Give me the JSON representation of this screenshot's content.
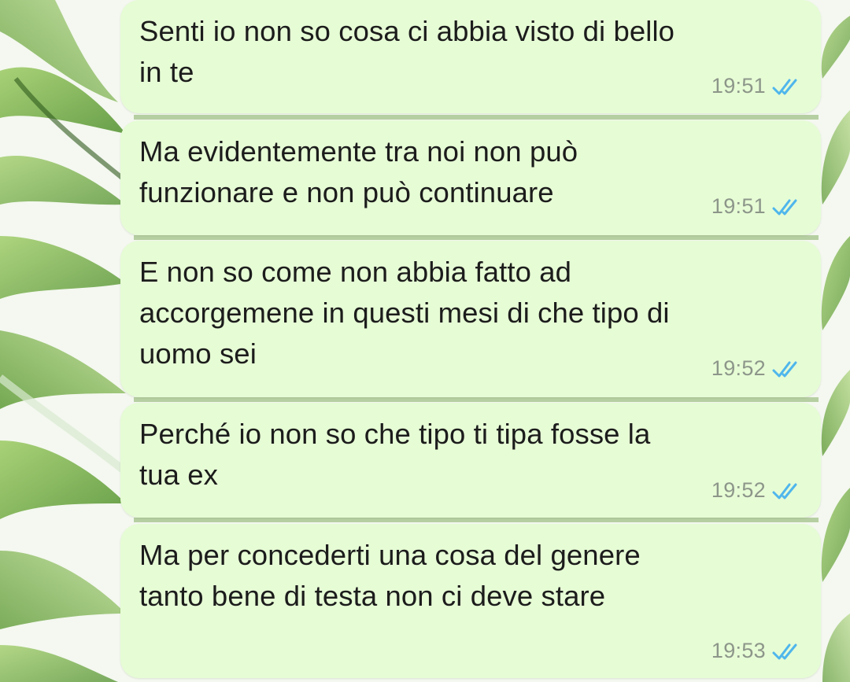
{
  "theme": {
    "bubble_color": "#e6fcd5",
    "text_color": "#1c1c1c",
    "time_color": "#8d968a",
    "read_tick_color": "#4fb6ec",
    "wallpaper_leaf_color": "#7fb94a"
  },
  "messages": [
    {
      "lines": [
        "Senti io non so cosa ci abbia visto di bello",
        "in te"
      ],
      "time": "19:51",
      "status_icon": "double-check-read-icon"
    },
    {
      "lines": [
        "Ma evidentemente tra noi non può",
        "funzionare e non può continuare"
      ],
      "time": "19:51",
      "status_icon": "double-check-read-icon"
    },
    {
      "lines": [
        "E non so come non abbia fatto ad",
        "accorgemene in questi mesi di che tipo di",
        "uomo sei"
      ],
      "time": "19:52",
      "status_icon": "double-check-read-icon"
    },
    {
      "lines": [
        "Perché io non so che tipo ti tipa fosse la",
        "tua ex"
      ],
      "time": "19:52",
      "status_icon": "double-check-read-icon"
    },
    {
      "lines": [
        "Ma per concederti una cosa del genere",
        "tanto bene di testa non ci deve stare"
      ],
      "time": "19:53",
      "status_icon": "double-check-read-icon"
    }
  ]
}
